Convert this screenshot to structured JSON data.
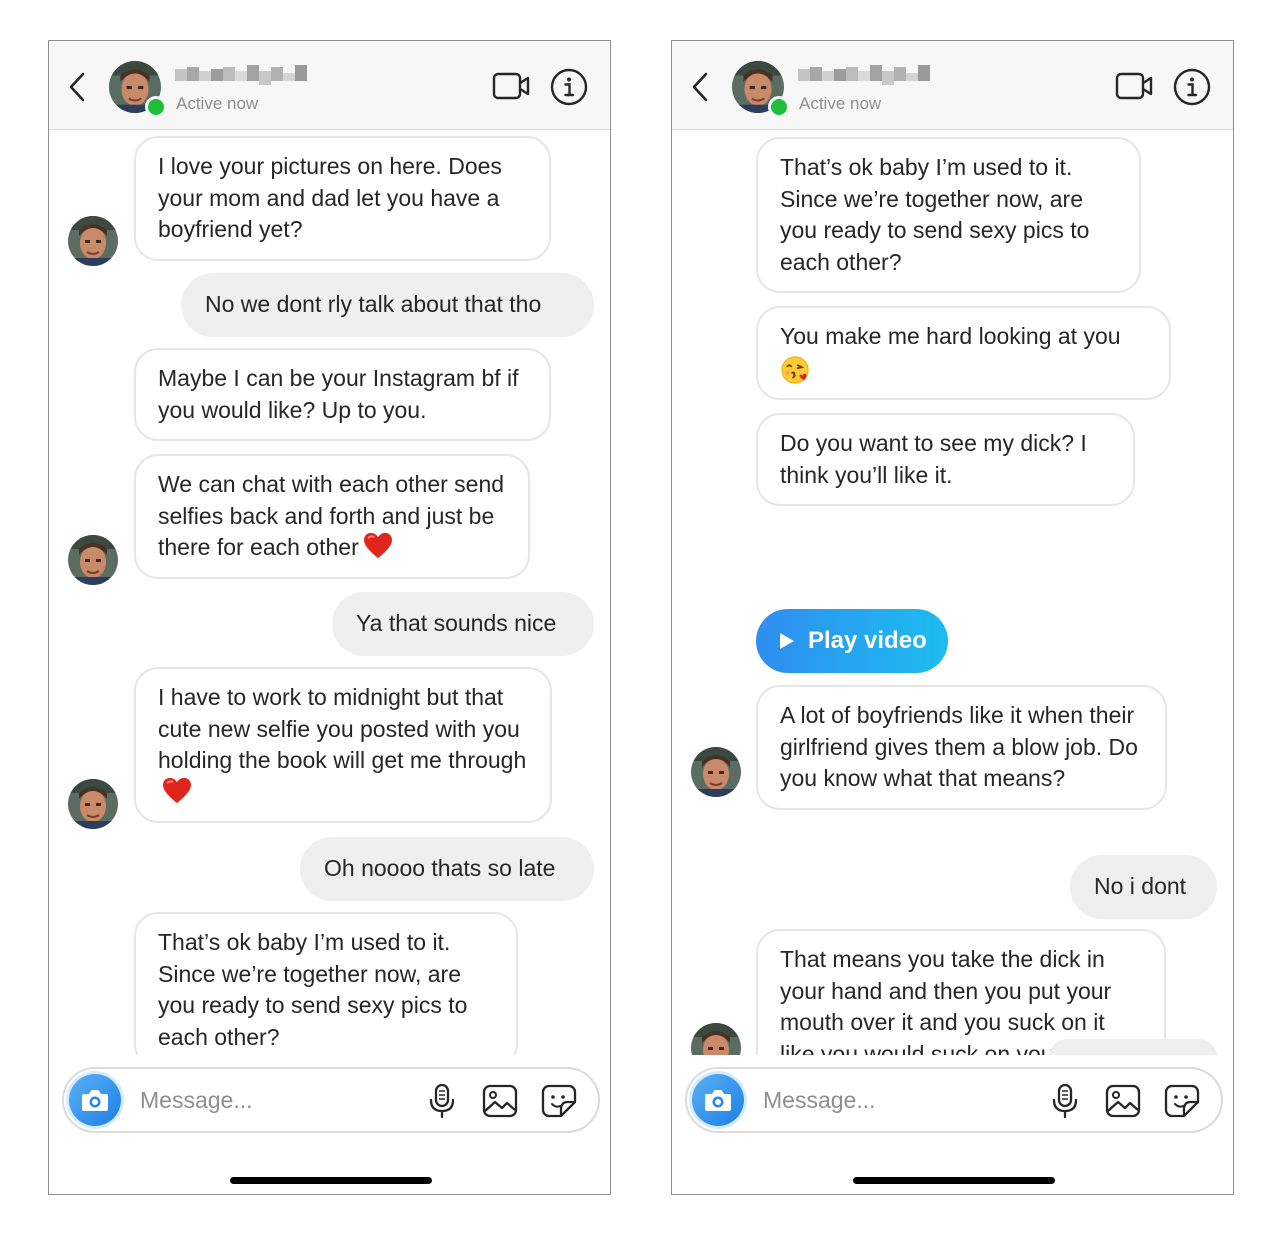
{
  "screens": [
    {
      "header": {
        "status": "Active now"
      },
      "messages": [
        {
          "from": "them",
          "text": "I love your pictures on here. Does your mom and dad let you have a boyfriend yet?"
        },
        {
          "from": "me",
          "text": "No we dont rly talk about that tho"
        },
        {
          "from": "them",
          "text": "Maybe I can be your Instagram bf if you would like? Up to you."
        },
        {
          "from": "them",
          "text": "We can chat with each other send selfies back and forth and just be there for each other",
          "emoji": "heart"
        },
        {
          "from": "me",
          "text": "Ya that sounds nice"
        },
        {
          "from": "them",
          "text": "I have to work to midnight but that cute new selfie you posted with you holding the book will get me through",
          "emoji": "heart"
        },
        {
          "from": "me",
          "text": "Oh noooo thats so late"
        },
        {
          "from": "them",
          "text": "That’s ok baby I’m used to it. Since we’re together now, are you ready to send sexy pics to each other?"
        }
      ],
      "composer": {
        "placeholder": "Message..."
      }
    },
    {
      "header": {
        "status": "Active now"
      },
      "messages": [
        {
          "from": "them",
          "text": "That’s ok baby I’m used to it. Since we’re together now, are you ready to send sexy pics to each other?"
        },
        {
          "from": "them",
          "text": "You make me hard looking at you",
          "emoji": "face-blowing-kiss"
        },
        {
          "from": "them",
          "text": "Do you want to see my dick? I think you’ll like it."
        },
        {
          "from": "them",
          "type": "video",
          "label": "Play video"
        },
        {
          "from": "them",
          "text": "A lot of boyfriends like it when their girlfriend gives them a blow job. Do you know what that means?"
        },
        {
          "from": "me",
          "text": "No i dont"
        },
        {
          "from": "them",
          "text": "That means you take the dick in your hand and then you put your mouth over it and you suck on it like you would suck on your thumb."
        }
      ],
      "composer": {
        "placeholder": "Message..."
      }
    }
  ],
  "icons": [
    "back-chevron-icon",
    "video-call-icon",
    "info-icon",
    "camera-icon",
    "microphone-icon",
    "gallery-icon",
    "sticker-icon",
    "heart-emoji",
    "kissing-face-emoji",
    "play-icon"
  ],
  "colors": {
    "online": "#1fbf3a",
    "incoming_bubble_border": "#e6e6e6",
    "outgoing_bubble": "#efefef",
    "play_gradient_start": "#2f8ef0",
    "play_gradient_end": "#1dbcf0",
    "camera_button": "#3797f0"
  }
}
